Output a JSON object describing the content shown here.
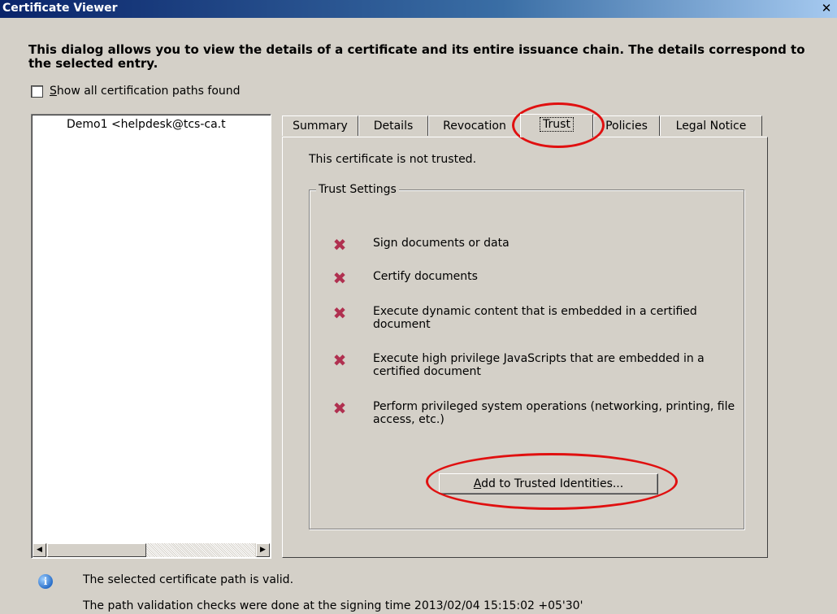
{
  "window": {
    "title": "Certificate Viewer",
    "close_glyph": "✕"
  },
  "intro_text": "This dialog allows you to view the details of a certificate and its entire issuance chain. The details correspond to the selected entry.",
  "show_paths": {
    "label_prefix": "S",
    "label_rest": "how all certification paths found",
    "checked": false
  },
  "tree": {
    "entry": "Demo1 <helpdesk@tcs-ca.t"
  },
  "tabs": [
    {
      "label": "Summary"
    },
    {
      "label": "Details"
    },
    {
      "label": "Revocation"
    },
    {
      "label": "Trust",
      "active": true
    },
    {
      "label": "Policies"
    },
    {
      "label": "Legal Notice"
    }
  ],
  "trust_panel": {
    "status": "This certificate is not trusted.",
    "group_title": "Trust Settings",
    "items": [
      {
        "icon": "red-x-icon",
        "text": "Sign documents or data"
      },
      {
        "icon": "red-x-icon",
        "text": "Certify documents"
      },
      {
        "icon": "red-x-icon",
        "text": "Execute dynamic content that is embedded in a certified document"
      },
      {
        "icon": "red-x-icon",
        "text": "Execute high privilege JavaScripts that are embedded in a certified document"
      },
      {
        "icon": "red-x-icon",
        "text": "Perform privileged system operations (networking, printing, file access, etc.)"
      }
    ],
    "add_button_prefix": "A",
    "add_button_rest": "dd to Trusted Identities..."
  },
  "footer": {
    "status_valid": "The selected certificate path is valid.",
    "status_time": "The path validation checks were done at the signing time 2013/02/04 15:15:02 +05'30'"
  },
  "colors": {
    "annotation_circle": "#e01010",
    "deny_icon": "#b03050",
    "title_bar": "#0a246a"
  }
}
